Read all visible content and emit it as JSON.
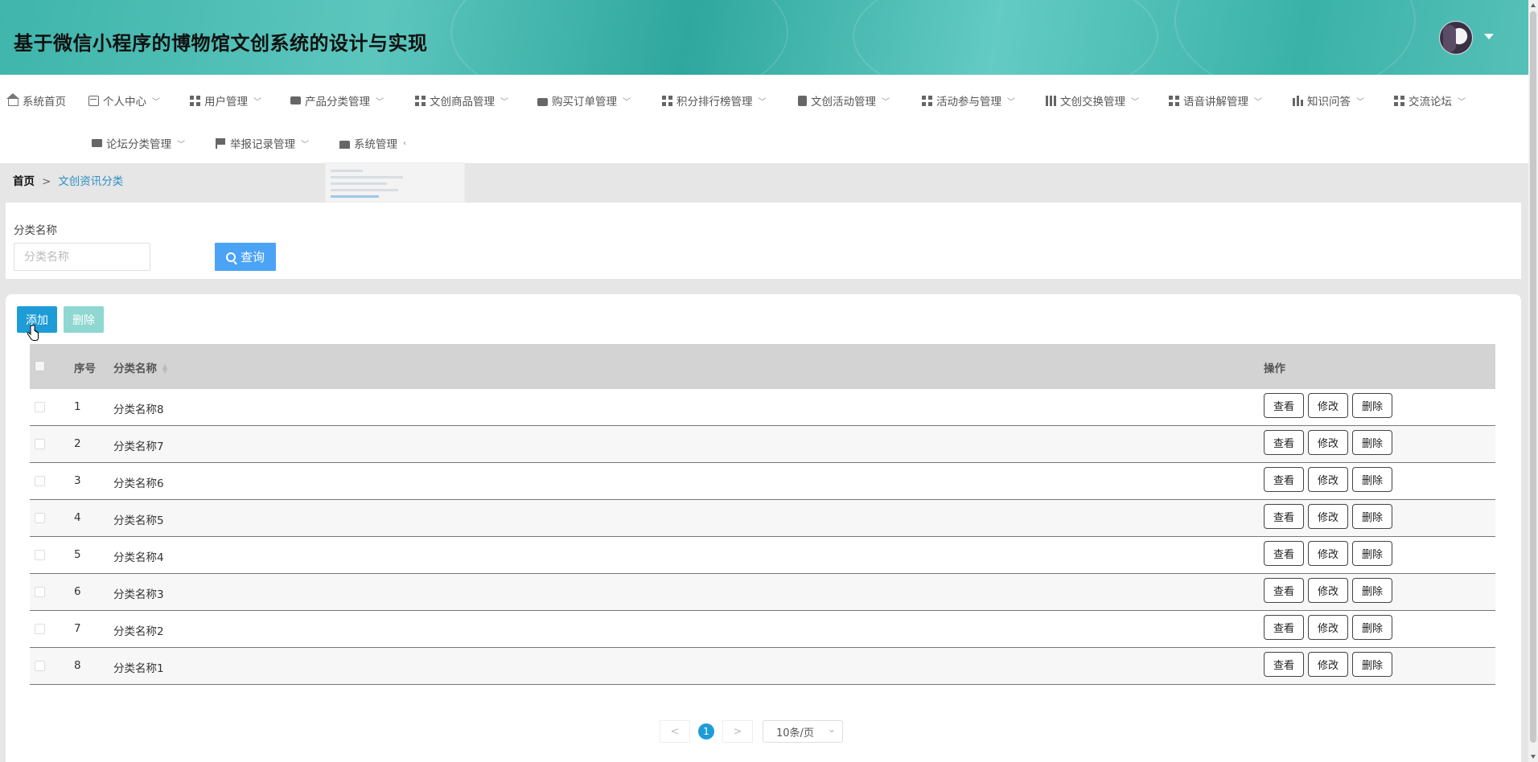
{
  "header": {
    "title": "基于微信小程序的博物馆文创系统的设计与实现"
  },
  "nav": {
    "items": [
      {
        "label": "系统首页",
        "icon": "home-icon"
      },
      {
        "label": "个人中心",
        "icon": "card-icon"
      },
      {
        "label": "用户管理",
        "icon": "grid-icon"
      },
      {
        "label": "产品分类管理",
        "icon": "chat-icon"
      },
      {
        "label": "文创商品管理",
        "icon": "grid-icon"
      },
      {
        "label": "购买订单管理",
        "icon": "briefcase-icon"
      },
      {
        "label": "积分排行榜管理",
        "icon": "grid-icon"
      },
      {
        "label": "文创活动管理",
        "icon": "clipboard-icon"
      },
      {
        "label": "活动参与管理",
        "icon": "grid-icon"
      },
      {
        "label": "文创交换管理",
        "icon": "table-grid-icon"
      },
      {
        "label": "语音讲解管理",
        "icon": "grid-icon"
      },
      {
        "label": "知识问答",
        "icon": "bar-chart-icon"
      },
      {
        "label": "交流论坛",
        "icon": "grid-icon"
      },
      {
        "label": "论坛分类管理",
        "icon": "monitor-icon"
      },
      {
        "label": "举报记录管理",
        "icon": "flag-icon"
      },
      {
        "label": "系统管理",
        "icon": "thumb-icon"
      }
    ]
  },
  "breadcrumb": {
    "home": "首页",
    "separator": ">",
    "current": "文创资讯分类"
  },
  "search": {
    "label": "分类名称",
    "placeholder": "分类名称",
    "value": "",
    "button": "查询"
  },
  "actions": {
    "add": "添加",
    "delete": "删除"
  },
  "table": {
    "headers": {
      "index": "序号",
      "name": "分类名称",
      "ops": "操作"
    },
    "rows": [
      {
        "index": "1",
        "name": "分类名称8"
      },
      {
        "index": "2",
        "name": "分类名称7"
      },
      {
        "index": "3",
        "name": "分类名称6"
      },
      {
        "index": "4",
        "name": "分类名称5"
      },
      {
        "index": "5",
        "name": "分类名称4"
      },
      {
        "index": "6",
        "name": "分类名称3"
      },
      {
        "index": "7",
        "name": "分类名称2"
      },
      {
        "index": "8",
        "name": "分类名称1"
      }
    ],
    "row_buttons": {
      "view": "查看",
      "edit": "修改",
      "delete": "删除"
    }
  },
  "pagination": {
    "prev": "<",
    "next": ">",
    "current_page": "1",
    "page_size": "10条/页"
  },
  "colors": {
    "accent": "#1e9cd8",
    "query": "#4ba3f5",
    "delete_disabled": "#8fd7d1",
    "header_teal": "#3fb5ab"
  }
}
